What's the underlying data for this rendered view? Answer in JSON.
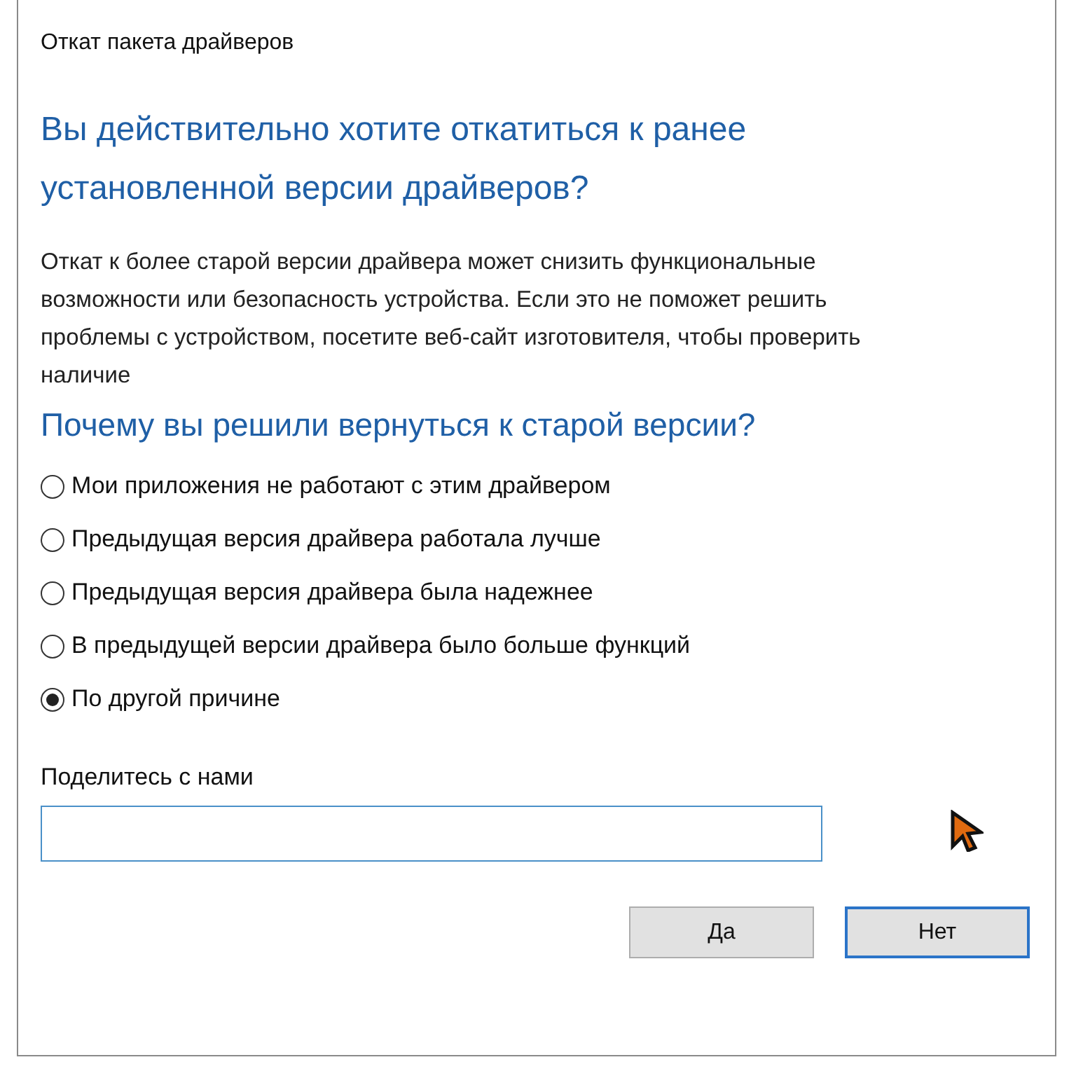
{
  "window": {
    "title": "Откат пакета драйверов"
  },
  "heading": "Вы действительно хотите откатиться к ранее установленной версии драйверов?",
  "description": "Откат к более старой версии драйвера может снизить функциональные возможности или безопасность устройства. Если это не поможет решить проблемы с устройством, посетите веб-сайт изготовителя, чтобы проверить наличие",
  "question": "Почему вы решили вернуться к старой версии?",
  "reasons": [
    {
      "label": "Мои приложения не работают с этим драйвером",
      "selected": false
    },
    {
      "label": "Предыдущая версия драйвера работала лучше",
      "selected": false
    },
    {
      "label": "Предыдущая версия драйвера была надежнее",
      "selected": false
    },
    {
      "label": "В предыдущей версии драйвера было больше функций",
      "selected": false
    },
    {
      "label": "По другой причине",
      "selected": true
    }
  ],
  "feedback": {
    "label": "Поделитесь с нами"
  },
  "buttons": [
    {
      "label": "Да",
      "default": false
    },
    {
      "label": "Нет",
      "default": true
    }
  ]
}
